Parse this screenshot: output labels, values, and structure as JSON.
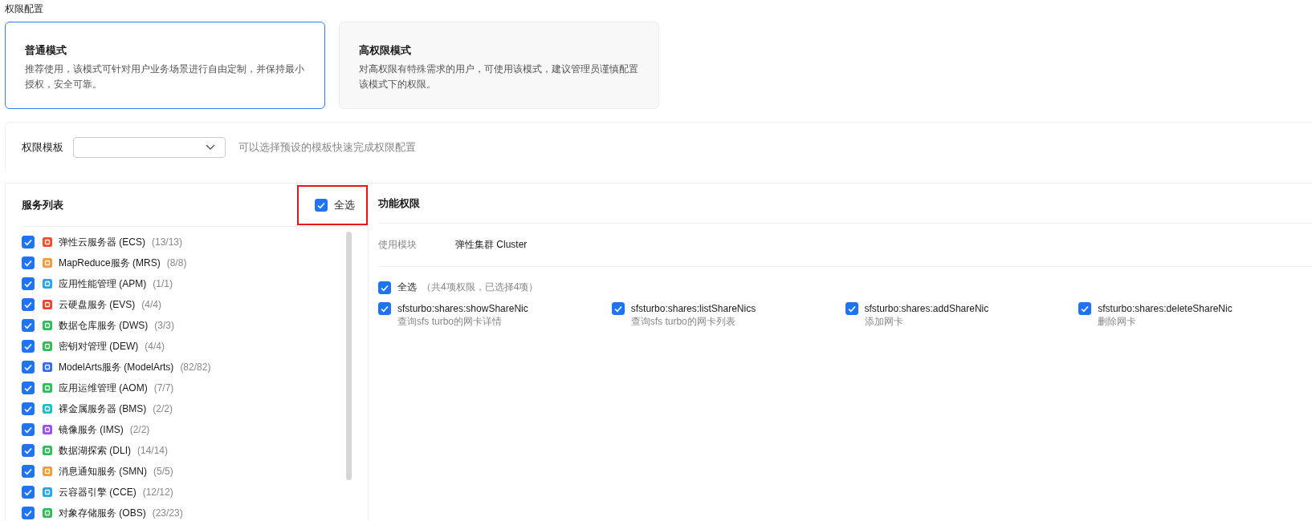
{
  "section_title": "权限配置",
  "modes": [
    {
      "title": "普通模式",
      "description": "推荐使用，该模式可针对用户业务场景进行自由定制，并保持最小授权，安全可靠。",
      "selected": true
    },
    {
      "title": "高权限模式",
      "description": "对高权限有特殊需求的用户，可使用该模式，建议管理员谨慎配置该模式下的权限。",
      "selected": false
    }
  ],
  "template": {
    "label": "权限模板",
    "hint": "可以选择预设的模板快速完成权限配置"
  },
  "service_list": {
    "title": "服务列表",
    "select_all": {
      "label": "全选",
      "checked": true,
      "highlighted": true
    },
    "items": [
      {
        "name": "弹性云服务器 (ECS)",
        "count": "(13/13)",
        "checked": true,
        "color": "#f0502d"
      },
      {
        "name": "MapReduce服务 (MRS)",
        "count": "(8/8)",
        "checked": true,
        "color": "#f59a3d"
      },
      {
        "name": "应用性能管理 (APM)",
        "count": "(1/1)",
        "checked": true,
        "color": "#2aa5e8"
      },
      {
        "name": "云硬盘服务 (EVS)",
        "count": "(4/4)",
        "checked": true,
        "color": "#f0432d"
      },
      {
        "name": "数据仓库服务 (DWS)",
        "count": "(3/3)",
        "checked": true,
        "color": "#2dbd5a"
      },
      {
        "name": "密钥对管理 (DEW)",
        "count": "(4/4)",
        "checked": true,
        "color": "#2dbd5a"
      },
      {
        "name": "ModelArts服务 (ModelArts)",
        "count": "(82/82)",
        "checked": true,
        "color": "#2f6ff0"
      },
      {
        "name": "应用运维管理 (AOM)",
        "count": "(7/7)",
        "checked": true,
        "color": "#2dbd5a"
      },
      {
        "name": "裸金属服务器 (BMS)",
        "count": "(2/2)",
        "checked": true,
        "color": "#1cc0c8"
      },
      {
        "name": "镜像服务 (IMS)",
        "count": "(2/2)",
        "checked": true,
        "color": "#9a52e8"
      },
      {
        "name": "数据湖探索 (DLI)",
        "count": "(14/14)",
        "checked": true,
        "color": "#2dbd5a"
      },
      {
        "name": "消息通知服务 (SMN)",
        "count": "(5/5)",
        "checked": true,
        "color": "#f59a3d"
      },
      {
        "name": "云容器引擎 (CCE)",
        "count": "(12/12)",
        "checked": true,
        "color": "#2aa5e8"
      },
      {
        "name": "对象存储服务 (OBS)",
        "count": "(23/23)",
        "checked": true,
        "color": "#2dbd5a"
      }
    ]
  },
  "function_permissions": {
    "title": "功能权限",
    "module_label": "使用模块",
    "module_value": "弹性集群 Cluster",
    "select_all": {
      "label": "全选",
      "summary": "（共4项权限，已选择4项）",
      "checked": true
    },
    "permissions": [
      {
        "action": "sfsturbo:shares:showShareNic",
        "description": "查询sfs turbo的网卡详情",
        "checked": true
      },
      {
        "action": "sfsturbo:shares:listShareNics",
        "description": "查询sfs turbo的网卡列表",
        "checked": true
      },
      {
        "action": "sfsturbo:shares:addShareNic",
        "description": "添加网卡",
        "checked": true
      },
      {
        "action": "sfsturbo:shares:deleteShareNic",
        "description": "删除网卡",
        "checked": true
      }
    ]
  }
}
